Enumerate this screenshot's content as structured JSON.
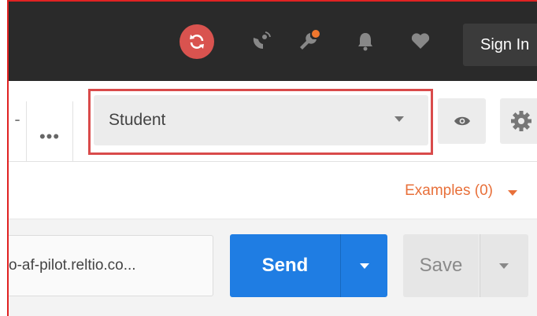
{
  "header": {
    "sign_in_label": "Sign In",
    "icons": [
      "sync-icon",
      "satellite-icon",
      "wrench-icon",
      "bell-icon",
      "heart-icon"
    ],
    "sync_color": "#d9534f",
    "notification_dot_color": "#f0772e"
  },
  "tabs": {
    "partial_tab_label": "-",
    "more_label": "•••"
  },
  "environment": {
    "selected": "Student",
    "highlight_color": "#d94b4b"
  },
  "examples": {
    "label": "Examples (0)",
    "color": "#e8703a"
  },
  "request": {
    "url_value": "o-af-pilot.reltio.co...",
    "send_label": "Send",
    "save_label": "Save",
    "send_color": "#1f7de3"
  }
}
